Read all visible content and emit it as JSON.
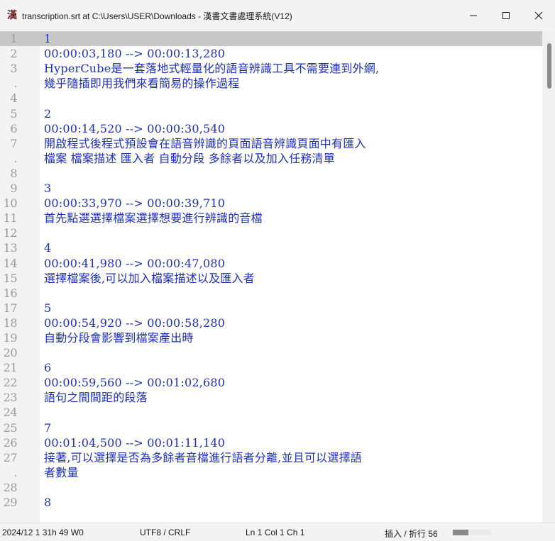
{
  "window": {
    "icon_glyph": "漢",
    "title": "transcription.srt at C:\\Users\\USER\\Downloads - 漢書文書處理系統(V12)"
  },
  "editor": {
    "lines": [
      {
        "num": "1",
        "text": "1"
      },
      {
        "num": "2",
        "text": "00:00:03,180 --> 00:00:13,280"
      },
      {
        "num": "3",
        "text": "HyperCube是一套落地式輕量化的語音辨識工具不需要連到外網,"
      },
      {
        "num": ".",
        "text": "幾乎隨插即用我們來看簡易的操作過程"
      },
      {
        "num": "4",
        "text": ""
      },
      {
        "num": "5",
        "text": "2"
      },
      {
        "num": "6",
        "text": "00:00:14,520 --> 00:00:30,540"
      },
      {
        "num": "7",
        "text": "開啟程式後程式預設會在語音辨識的頁面語音辨識頁面中有匯入"
      },
      {
        "num": ".",
        "text": "檔案 檔案描述 匯入者 自動分段 多餘者以及加入任務清單"
      },
      {
        "num": "8",
        "text": ""
      },
      {
        "num": "9",
        "text": "3"
      },
      {
        "num": "10",
        "text": "00:00:33,970 --> 00:00:39,710"
      },
      {
        "num": "11",
        "text": "首先點選選擇檔案選擇想要進行辨識的音檔"
      },
      {
        "num": "12",
        "text": ""
      },
      {
        "num": "13",
        "text": "4"
      },
      {
        "num": "14",
        "text": "00:00:41,980 --> 00:00:47,080"
      },
      {
        "num": "15",
        "text": "選擇檔案後,可以加入檔案描述以及匯入者"
      },
      {
        "num": "16",
        "text": ""
      },
      {
        "num": "17",
        "text": "5"
      },
      {
        "num": "18",
        "text": "00:00:54,920 --> 00:00:58,280"
      },
      {
        "num": "19",
        "text": "自動分段會影響到檔案產出時"
      },
      {
        "num": "20",
        "text": ""
      },
      {
        "num": "21",
        "text": "6"
      },
      {
        "num": "22",
        "text": "00:00:59,560 --> 00:01:02,680"
      },
      {
        "num": "23",
        "text": "語句之間間距的段落"
      },
      {
        "num": "24",
        "text": ""
      },
      {
        "num": "25",
        "text": "7"
      },
      {
        "num": "26",
        "text": "00:01:04,500 --> 00:01:11,140"
      },
      {
        "num": "27",
        "text": "接著,可以選擇是否為多餘者音檔進行語者分離,並且可以選擇語"
      },
      {
        "num": ".",
        "text": "者數量"
      },
      {
        "num": "28",
        "text": ""
      },
      {
        "num": "29",
        "text": "8"
      }
    ],
    "current_line_index": 0
  },
  "status": {
    "date_info": "2024/12 1 31h 49 W0",
    "encoding": "UTF8 / CRLF",
    "position": "Ln 1  Col 1  Ch 1",
    "mode": "插入 / 折行 56",
    "progress": 0.4
  },
  "colors": {
    "text": "#1e2fb8",
    "line_number": "#9a9a9a",
    "current_line": "#c8c8c8",
    "icon": "#6b1f1f"
  }
}
